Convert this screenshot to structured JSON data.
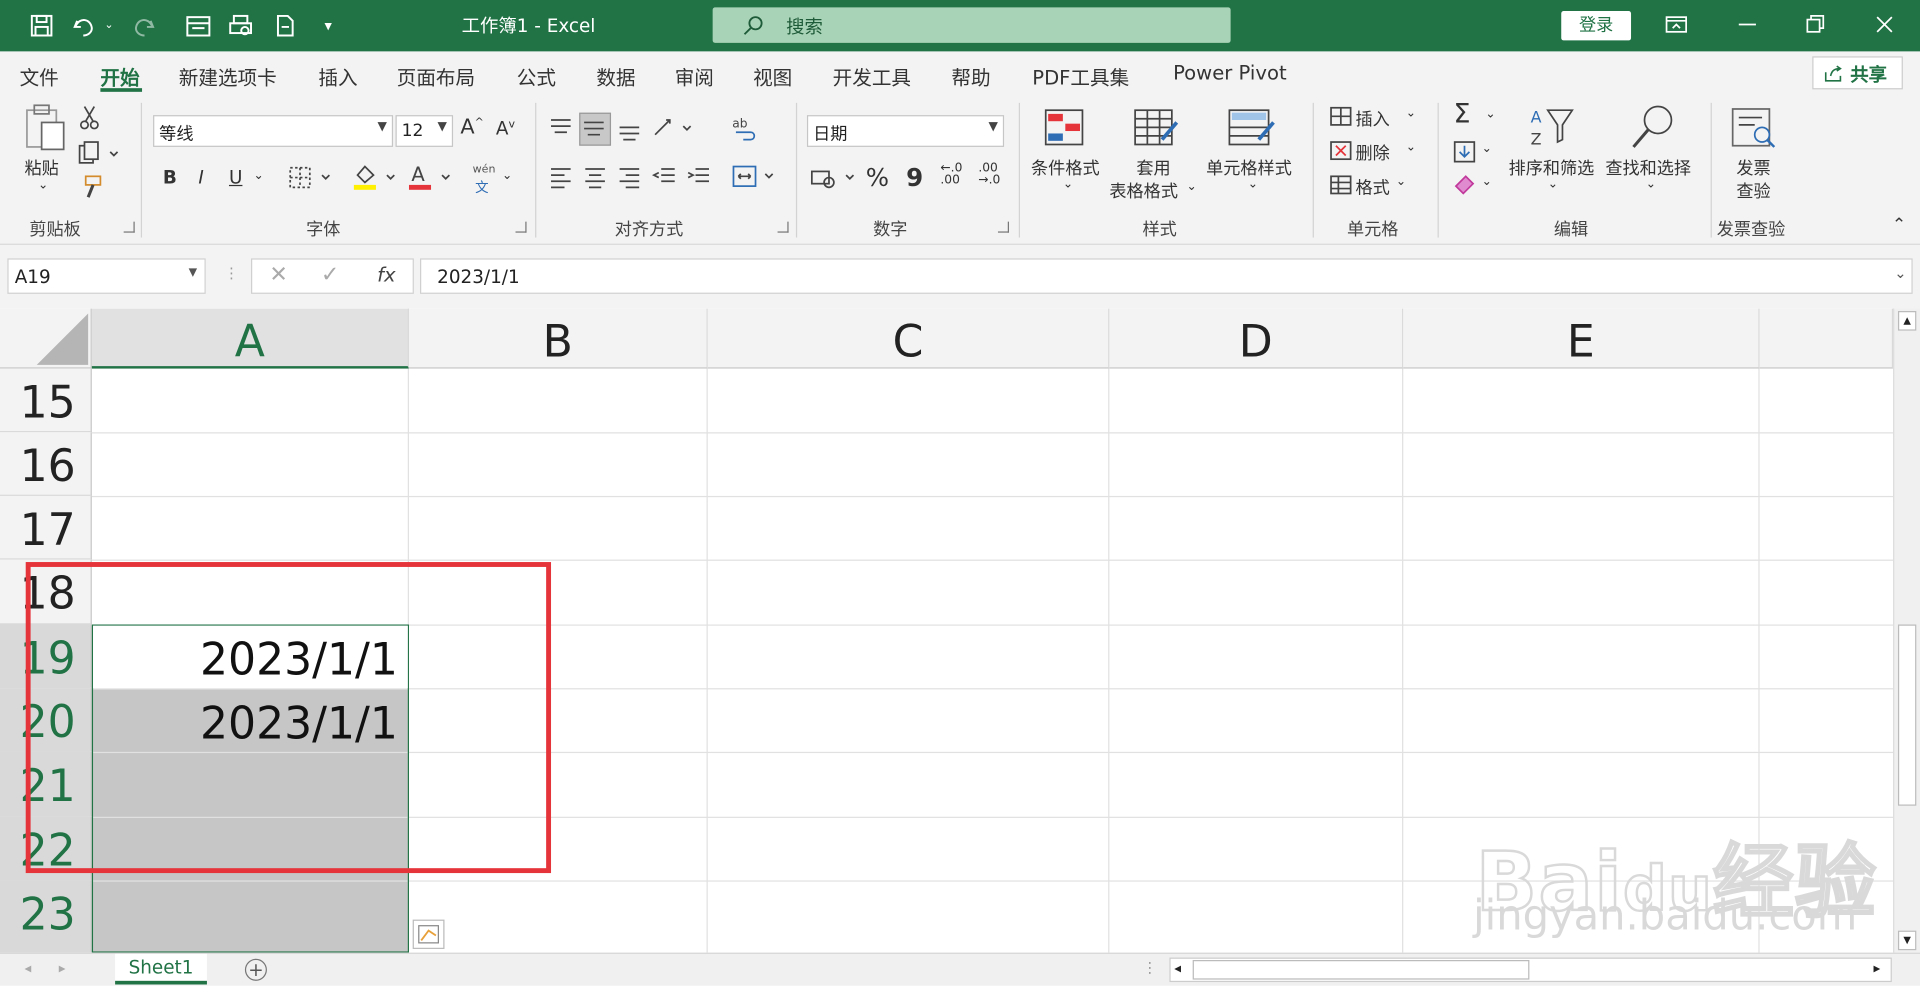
{
  "title_bar": {
    "doc_title": "工作簿1  -  Excel",
    "search_placeholder": "搜索",
    "login_label": "登录"
  },
  "menu_tabs": [
    "文件",
    "开始",
    "新建选项卡",
    "插入",
    "页面布局",
    "公式",
    "数据",
    "审阅",
    "视图",
    "开发工具",
    "帮助",
    "PDF工具集",
    "Power Pivot"
  ],
  "active_tab": "开始",
  "share_label": "共享",
  "ribbon": {
    "clipboard": {
      "paste": "粘贴",
      "group": "剪贴板"
    },
    "font": {
      "name": "等线",
      "size": "12",
      "group": "字体",
      "bold": "B",
      "italic": "I",
      "underline": "U",
      "phonetic_top": "wén",
      "phonetic_bottom": "文"
    },
    "alignment": {
      "group": "对齐方式"
    },
    "number": {
      "format": "日期",
      "percent": "%",
      "comma": "9",
      "group": "数字"
    },
    "styles": {
      "conditional": "条件格式",
      "table_1": "套用",
      "table_2": "表格格式",
      "cell_styles": "单元格样式",
      "group": "样式"
    },
    "cells": {
      "insert": "插入",
      "delete": "删除",
      "format": "格式",
      "group": "单元格"
    },
    "editing": {
      "sort": "排序和筛选",
      "find": "查找和选择",
      "group": "编辑"
    },
    "invoice": {
      "check_1": "发票",
      "check_2": "查验",
      "group": "发票查验"
    }
  },
  "formula_bar": {
    "name_box": "A19",
    "fx": "fx",
    "formula": "2023/1/1"
  },
  "columns": [
    "A",
    "B",
    "C",
    "D",
    "E"
  ],
  "selected_column": "A",
  "rows": [
    "15",
    "16",
    "17",
    "18",
    "19",
    "20",
    "21",
    "22",
    "23"
  ],
  "cells": {
    "A19": "2023/1/1",
    "A20": "2023/1/1"
  },
  "sheet_tab": "Sheet1",
  "colors": {
    "excel_green": "#217346",
    "highlight_red": "#e5343a",
    "selection_fill": "#c6c6c6"
  }
}
